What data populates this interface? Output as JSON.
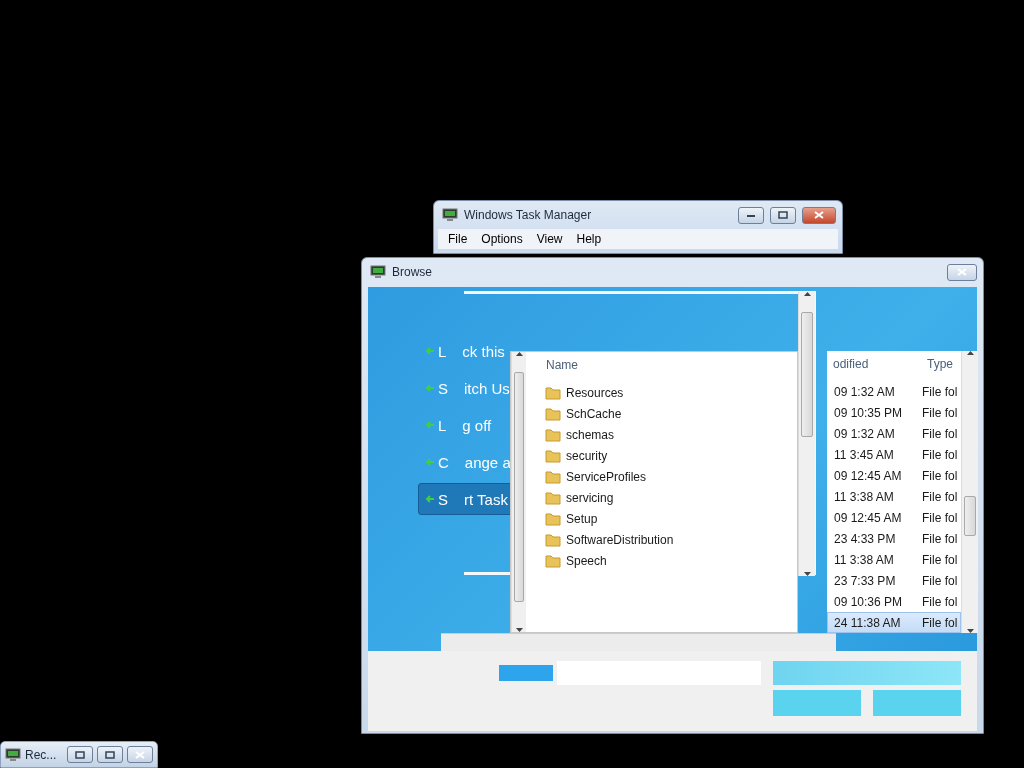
{
  "task_manager": {
    "title": "Windows Task Manager",
    "menu": [
      "File",
      "Options",
      "View",
      "Help"
    ]
  },
  "browse": {
    "title": "Browse",
    "options": [
      {
        "initial": "L",
        "rest": "ck this",
        "selected": false
      },
      {
        "initial": "S",
        "rest": "itch Us",
        "selected": false
      },
      {
        "initial": "L",
        "rest": "g off",
        "selected": false
      },
      {
        "initial": "C",
        "rest": "ange a",
        "selected": false
      },
      {
        "initial": "S",
        "rest": "rt Task",
        "selected": true
      }
    ],
    "file_list": {
      "header": "Name",
      "rows": [
        "Resources",
        "SchCache",
        "schemas",
        "security",
        "ServiceProfiles",
        "servicing",
        "Setup",
        "SoftwareDistribution",
        "Speech"
      ]
    },
    "details": {
      "header_modified": "odified",
      "header_type": "Type",
      "rows": [
        {
          "modified": "09 1:32 AM",
          "type": "File fol",
          "selected": false
        },
        {
          "modified": "09 10:35 PM",
          "type": "File fol",
          "selected": false
        },
        {
          "modified": "09 1:32 AM",
          "type": "File fol",
          "selected": false
        },
        {
          "modified": "11 3:45 AM",
          "type": "File fol",
          "selected": false
        },
        {
          "modified": "09 12:45 AM",
          "type": "File fol",
          "selected": false
        },
        {
          "modified": "11 3:38 AM",
          "type": "File fol",
          "selected": false
        },
        {
          "modified": "09 12:45 AM",
          "type": "File fol",
          "selected": false
        },
        {
          "modified": "23 4:33 PM",
          "type": "File fol",
          "selected": false
        },
        {
          "modified": "11 3:38 AM",
          "type": "File fol",
          "selected": false
        },
        {
          "modified": "23 7:33 PM",
          "type": "File fol",
          "selected": false
        },
        {
          "modified": "09 10:36 PM",
          "type": "File fol",
          "selected": false
        },
        {
          "modified": "24 11:38 AM",
          "type": "File fol",
          "selected": true
        }
      ]
    }
  },
  "taskbar_window": {
    "title": "Rec..."
  }
}
